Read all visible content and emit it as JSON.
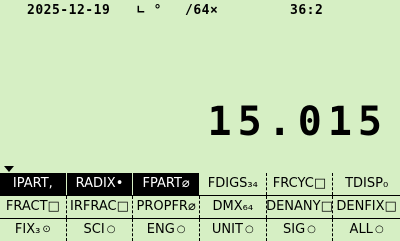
{
  "status": {
    "date": "2025-12-19",
    "angle": "∟ °",
    "complex": "/64×",
    "time": "36:2"
  },
  "display": {
    "result": "15.015"
  },
  "menu": {
    "row1": [
      {
        "label": "IPART,",
        "inverted": true
      },
      {
        "label": "RADIX•",
        "inverted": true
      },
      {
        "label": "FPART⌀",
        "inverted": true
      },
      {
        "label": "FDIGS₃₄",
        "inverted": false
      },
      {
        "label": "FRCYC□",
        "inverted": false
      },
      {
        "label": "TDISP₀",
        "inverted": false
      }
    ],
    "row2": [
      {
        "label": "FRACT□"
      },
      {
        "label": "IRFRAC□"
      },
      {
        "label": "PROPFR⌀"
      },
      {
        "label": "DMX₆₄"
      },
      {
        "label": "DENANY□"
      },
      {
        "label": "DENFIX□"
      }
    ],
    "row3": [
      {
        "label": "FIX₃",
        "mark": "⊙"
      },
      {
        "label": "SCI",
        "mark": "○"
      },
      {
        "label": "ENG",
        "mark": "○"
      },
      {
        "label": "UNIT",
        "mark": "○"
      },
      {
        "label": "SIG",
        "mark": "○"
      },
      {
        "label": "ALL",
        "mark": "○"
      }
    ]
  }
}
